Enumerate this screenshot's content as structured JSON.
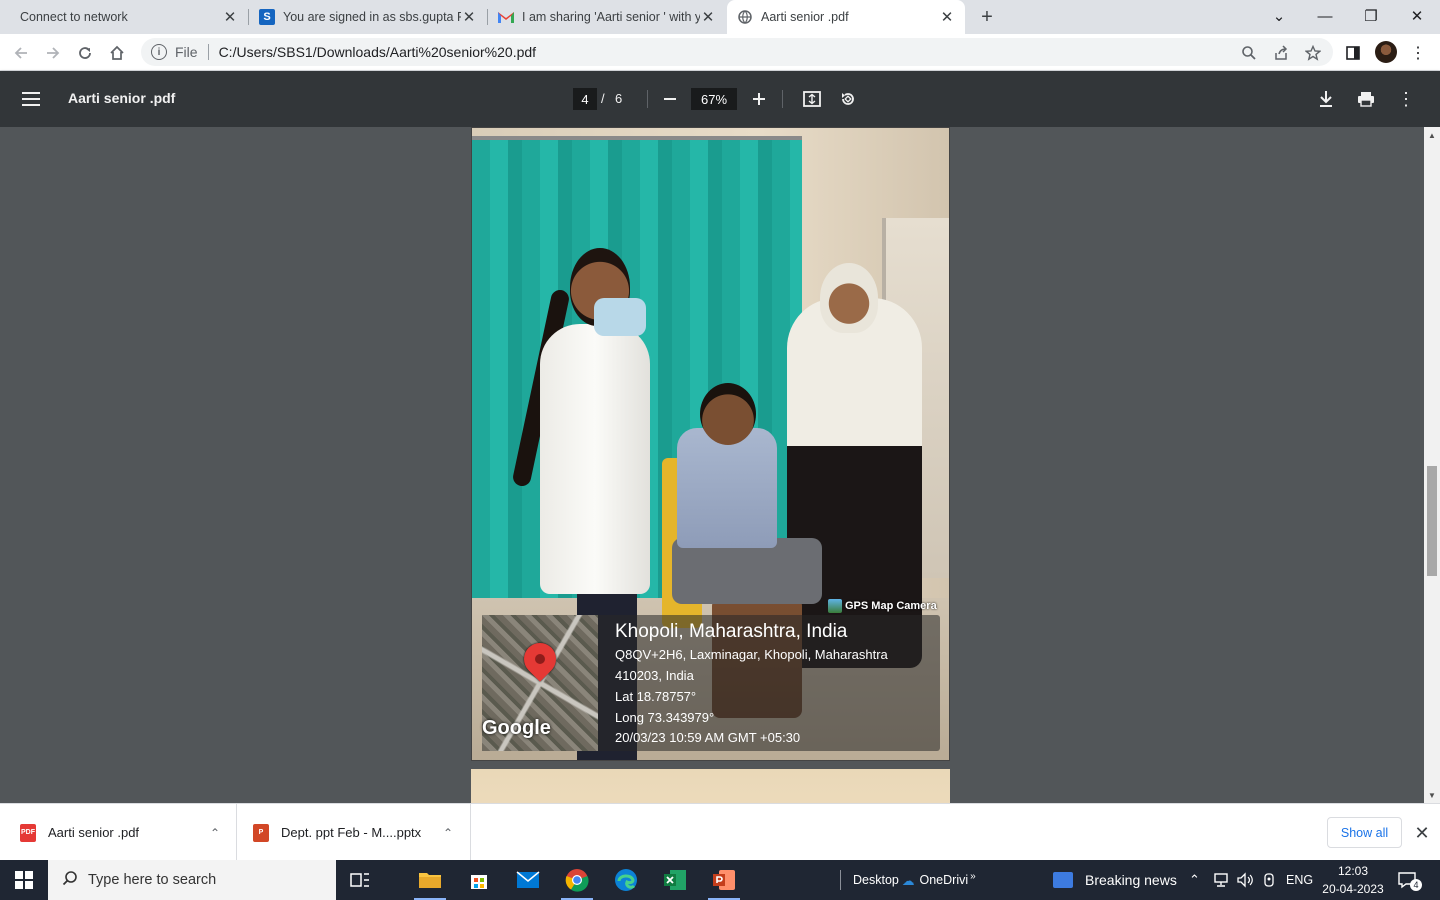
{
  "browser": {
    "tabs": [
      {
        "title": "Connect to network",
        "favicon": "none"
      },
      {
        "title": "You are signed in as sbs.gupta Re",
        "favicon": "s-logo-icon"
      },
      {
        "title": "I am sharing 'Aarti senior ' with y",
        "favicon": "gmail-icon"
      },
      {
        "title": "Aarti senior .pdf",
        "favicon": "globe-icon",
        "active": true
      }
    ],
    "address": {
      "scheme": "File",
      "url": "C:/Users/SBS1/Downloads/Aarti%20senior%20.pdf"
    }
  },
  "pdf": {
    "title": "Aarti senior .pdf",
    "current_page": "4",
    "page_separator": "/",
    "total_pages": "6",
    "zoom": "67%"
  },
  "photo": {
    "brand": "GPS Map Camera",
    "map_label": "Google",
    "city": "Khopoli, Maharashtra, India",
    "address_line1": "Q8QV+2H6, Laxminagar, Khopoli, Maharashtra",
    "address_line2": "410203, India",
    "lat": "Lat 18.78757°",
    "long": "Long 73.343979°",
    "timestamp": "20/03/23 10:59 AM GMT +05:30"
  },
  "downloads": {
    "items": [
      {
        "name": "Aarti senior .pdf",
        "type": "PDF"
      },
      {
        "name": "Dept. ppt Feb - M....pptx",
        "type": "P"
      }
    ],
    "show_all": "Show all"
  },
  "taskbar": {
    "search_placeholder": "Type here to search",
    "desktop_label": "Desktop",
    "onedrive_label": "OneDrivi",
    "news_label": "Breaking news",
    "language": "ENG",
    "time": "12:03",
    "date": "20-04-2023",
    "notification_count": "4"
  }
}
